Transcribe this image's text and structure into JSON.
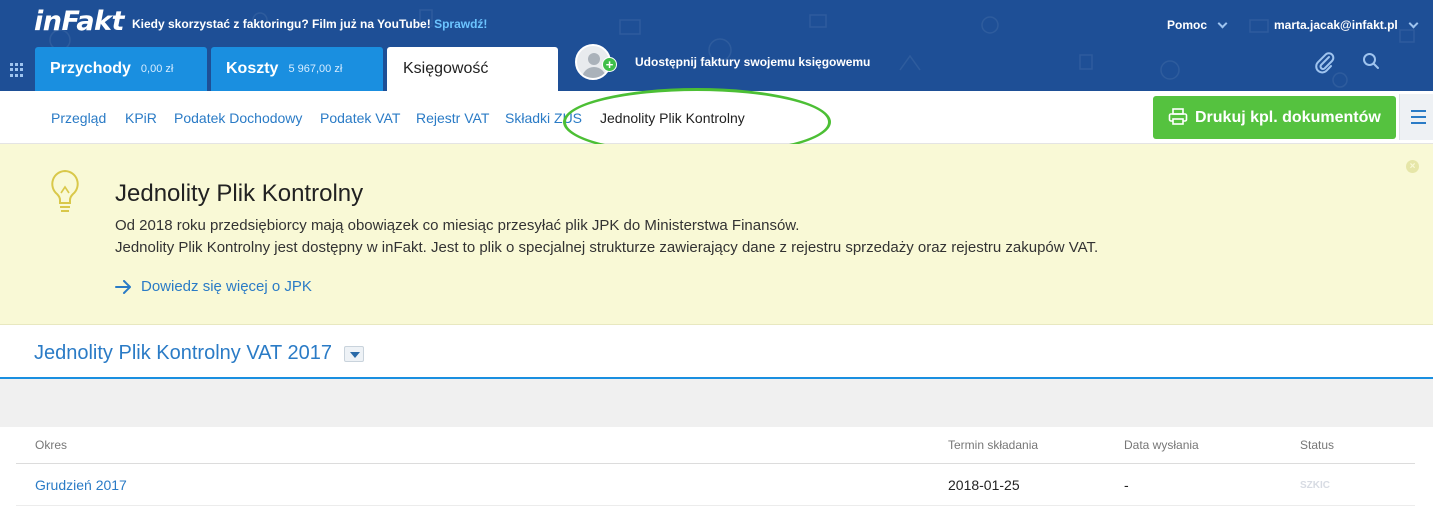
{
  "header": {
    "logo": "inFakt",
    "promo_text": "Kiedy skorzystać z faktoringu? Film już na YouTube!",
    "promo_link": "Sprawdź!",
    "help": "Pomoc",
    "user_email": "marta.jacak@infakt.pl",
    "tabs": [
      {
        "label": "Przychody",
        "value": "0,00 zł"
      },
      {
        "label": "Koszty",
        "value": "5 967,00 zł"
      },
      {
        "label": "Księgowość",
        "value": ""
      }
    ],
    "share_text": "Udostępnij faktury swojemu księgowemu"
  },
  "subnav": {
    "items": [
      "Przegląd",
      "KPiR",
      "Podatek Dochodowy",
      "Podatek VAT",
      "Rejestr VAT",
      "Składki ZUS",
      "Jednolity Plik Kontrolny"
    ],
    "print_button": "Drukuj kpl. dokumentów"
  },
  "banner": {
    "title": "Jednolity Plik Kontrolny",
    "line1": "Od 2018 roku przedsiębiorcy mają obowiązek co miesiąc przesyłać plik JPK do Ministerstwa Finansów.",
    "line2": "Jednolity Plik Kontrolny jest dostępny w inFakt. Jest to plik o specjalnej strukturze zawierający dane z rejestru sprzedaży oraz rejestru zakupów VAT.",
    "link": "Dowiedz się więcej o JPK",
    "close_glyph": "×"
  },
  "section": {
    "title": "Jednolity Plik Kontrolny VAT 2017"
  },
  "table": {
    "columns": [
      "Okres",
      "Termin składania",
      "Data wysłania",
      "Status"
    ],
    "rows": [
      {
        "period": "Grudzień 2017",
        "deadline": "2018-01-25",
        "sent": "-",
        "status": "SZKIC"
      }
    ]
  },
  "colors": {
    "header_bg": "#1e4f96",
    "tab_blue": "#1a8fe0",
    "link_blue": "#2a7bc6",
    "green": "#55c23f",
    "banner_bg": "#f9f9d6",
    "highlight_circle": "#4cbf35"
  },
  "icons": [
    "apps-grid-icon",
    "chevron-down-icon",
    "avatar-icon",
    "plus-icon",
    "paperclip-icon",
    "search-icon",
    "printer-icon",
    "hamburger-menu-icon",
    "lightbulb-icon",
    "close-icon",
    "arrow-right-icon",
    "dropdown-icon"
  ]
}
